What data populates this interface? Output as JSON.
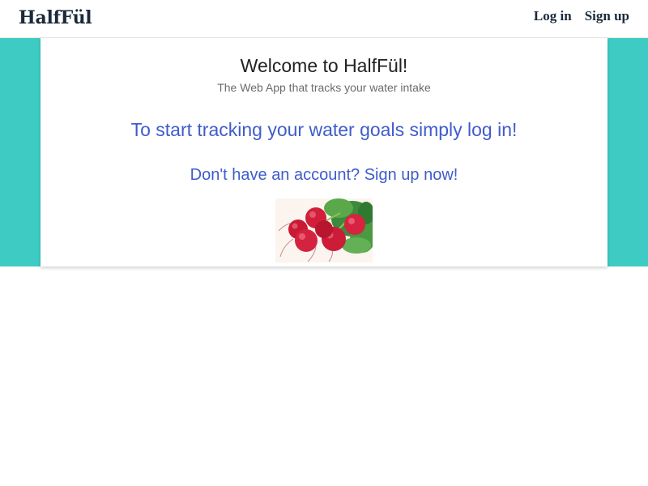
{
  "navbar": {
    "brand": "HalfFül",
    "links": [
      {
        "label": "Log in"
      },
      {
        "label": "Sign up"
      }
    ]
  },
  "colors": {
    "accent_band": "#3ecbc4",
    "link_blue": "#3f5ccc",
    "brand_dark": "#1b2a3a"
  },
  "main": {
    "title": "Welcome to HalfFül!",
    "subtitle": "The Web App that tracks your water intake",
    "login_cta": "To start tracking your water goals simply log in!",
    "signup_cta": "Don't have an account? Sign up now!",
    "image_icon": "radishes-image"
  }
}
